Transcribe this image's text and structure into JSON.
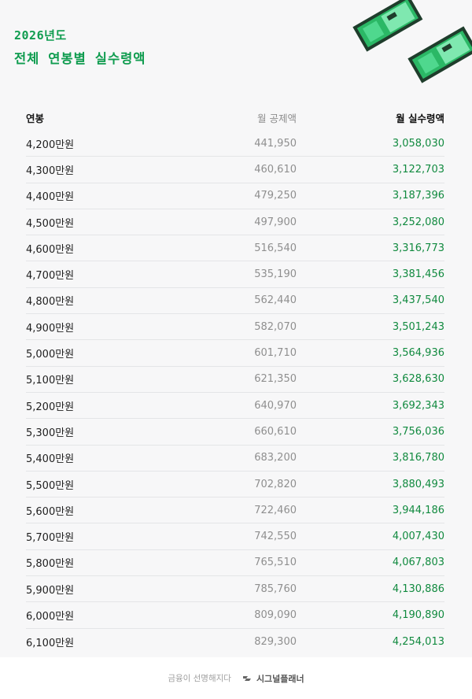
{
  "header": {
    "year": "2026년도",
    "title": "전체 연봉별 실수령액"
  },
  "table": {
    "headers": [
      "연봉",
      "월 공제액",
      "월 실수령액"
    ],
    "rows": [
      [
        "4,200만원",
        "441,950",
        "3,058,030"
      ],
      [
        "4,300만원",
        "460,610",
        "3,122,703"
      ],
      [
        "4,400만원",
        "479,250",
        "3,187,396"
      ],
      [
        "4,500만원",
        "497,900",
        "3,252,080"
      ],
      [
        "4,600만원",
        "516,540",
        "3,316,773"
      ],
      [
        "4,700만원",
        "535,190",
        "3,381,456"
      ],
      [
        "4,800만원",
        "562,440",
        "3,437,540"
      ],
      [
        "4,900만원",
        "582,070",
        "3,501,243"
      ],
      [
        "5,000만원",
        "601,710",
        "3,564,936"
      ],
      [
        "5,100만원",
        "621,350",
        "3,628,630"
      ],
      [
        "5,200만원",
        "640,970",
        "3,692,343"
      ],
      [
        "5,300만원",
        "660,610",
        "3,756,036"
      ],
      [
        "5,400만원",
        "683,200",
        "3,816,780"
      ],
      [
        "5,500만원",
        "702,820",
        "3,880,493"
      ],
      [
        "5,600만원",
        "722,460",
        "3,944,186"
      ],
      [
        "5,700만원",
        "742,550",
        "4,007,430"
      ],
      [
        "5,800만원",
        "765,510",
        "4,067,803"
      ],
      [
        "5,900만원",
        "785,760",
        "4,130,886"
      ],
      [
        "6,000만원",
        "809,090",
        "4,190,890"
      ],
      [
        "6,100만원",
        "829,300",
        "4,254,013"
      ]
    ]
  },
  "footer": {
    "tagline": "금융이 선명해지다",
    "brand": "시그널플래너",
    "logo_icon": "signal-logo-icon"
  },
  "colors": {
    "accent": "#0f9c4f",
    "value_green": "#118a3f",
    "muted": "#8f8f8f",
    "decor_dark": "#1f3d2c",
    "decor_light": "#35c47a"
  }
}
